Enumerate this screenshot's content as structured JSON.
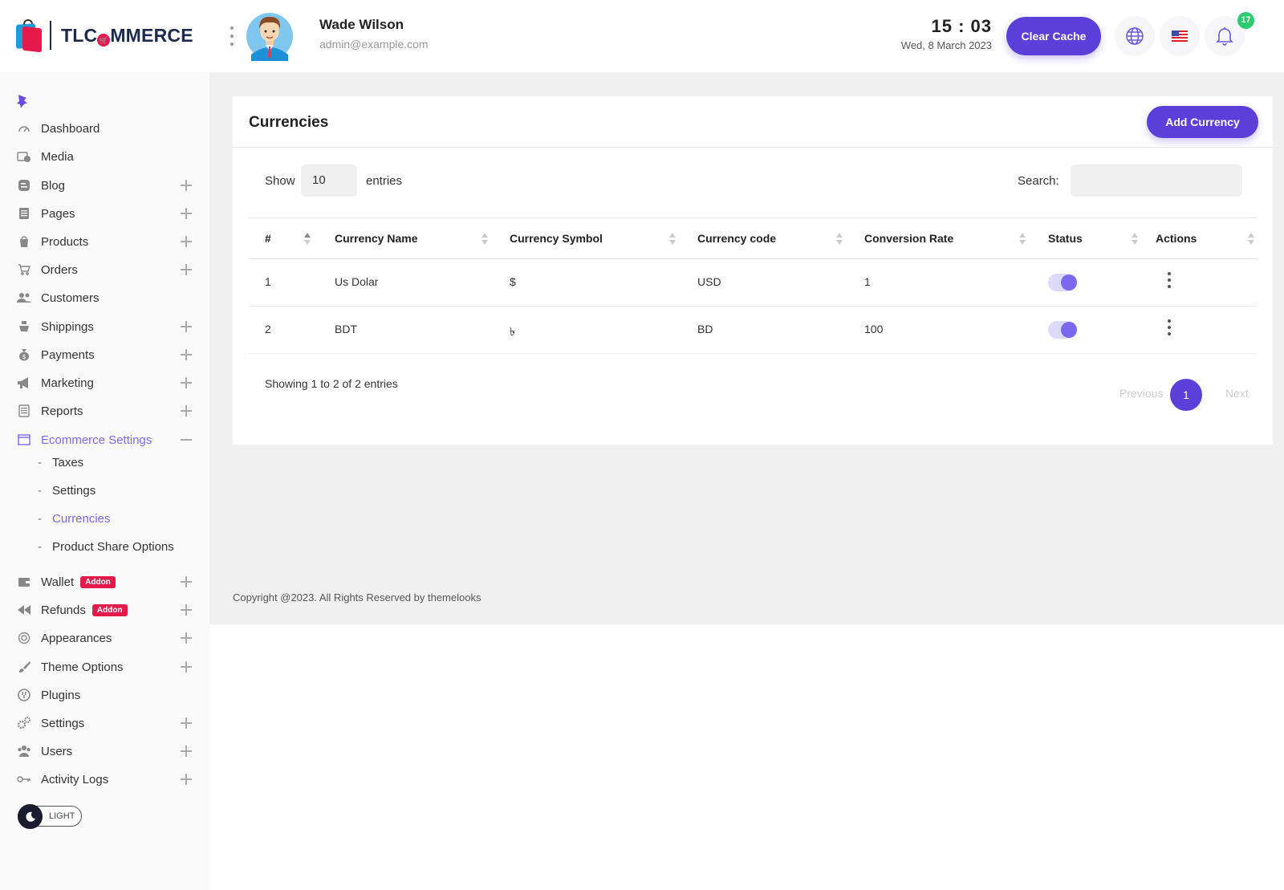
{
  "header": {
    "logo_text": "TLCOMMERCE",
    "user_name": "Wade Wilson",
    "user_email": "admin@example.com",
    "time": "15 : 03",
    "date": "Wed, 8 March 2023",
    "clear_cache_label": "Clear Cache",
    "notification_count": "17",
    "accent_color": "#5b3fd9"
  },
  "sidebar": {
    "items": [
      {
        "label": "Dashboard",
        "icon": "dashboard-icon",
        "expandable": false
      },
      {
        "label": "Media",
        "icon": "media-icon",
        "expandable": false
      },
      {
        "label": "Blog",
        "icon": "blog-icon",
        "expandable": true
      },
      {
        "label": "Pages",
        "icon": "pages-icon",
        "expandable": true
      },
      {
        "label": "Products",
        "icon": "products-icon",
        "expandable": true
      },
      {
        "label": "Orders",
        "icon": "cart-icon",
        "expandable": true
      },
      {
        "label": "Customers",
        "icon": "customers-icon",
        "expandable": false
      },
      {
        "label": "Shippings",
        "icon": "shipping-icon",
        "expandable": true
      },
      {
        "label": "Payments",
        "icon": "money-bag-icon",
        "expandable": true
      },
      {
        "label": "Marketing",
        "icon": "megaphone-icon",
        "expandable": true
      },
      {
        "label": "Reports",
        "icon": "report-icon",
        "expandable": true
      },
      {
        "label": "Ecommerce Settings",
        "icon": "window-icon",
        "expandable": true,
        "expanded": true
      }
    ],
    "sub_items": [
      {
        "label": "Taxes"
      },
      {
        "label": "Settings"
      },
      {
        "label": "Currencies",
        "active": true
      },
      {
        "label": "Product Share Options"
      }
    ],
    "items_after": [
      {
        "label": "Wallet",
        "icon": "wallet-icon",
        "badge": "Addon",
        "expandable": true
      },
      {
        "label": "Refunds",
        "icon": "rewind-icon",
        "badge": "Addon",
        "expandable": true
      },
      {
        "label": "Appearances",
        "icon": "appearance-icon",
        "expandable": true
      },
      {
        "label": "Theme Options",
        "icon": "brush-icon",
        "expandable": true
      },
      {
        "label": "Plugins",
        "icon": "plug-icon",
        "expandable": false
      },
      {
        "label": "Settings",
        "icon": "gears-icon",
        "expandable": true
      },
      {
        "label": "Users",
        "icon": "users-icon",
        "expandable": true
      },
      {
        "label": "Activity Logs",
        "icon": "key-icon",
        "expandable": true
      }
    ],
    "theme_toggle_label": "LIGHT"
  },
  "main": {
    "title": "Currencies",
    "add_button_label": "Add Currency",
    "show_label": "Show",
    "entries_value": "10",
    "entries_label": "entries",
    "search_label": "Search:",
    "search_value": "",
    "columns": [
      "#",
      "Currency Name",
      "Currency Symbol",
      "Currency code",
      "Conversion Rate",
      "Status",
      "Actions"
    ],
    "rows": [
      {
        "num": "1",
        "name": "Us Dolar",
        "symbol": "$",
        "code": "USD",
        "rate": "1",
        "status": true
      },
      {
        "num": "2",
        "name": "BDT",
        "symbol": "৳",
        "code": "BD",
        "rate": "100",
        "status": true
      }
    ],
    "showing_text": "Showing 1 to 2 of 2 entries",
    "pagination": {
      "previous": "Previous",
      "current": "1",
      "next": "Next"
    }
  },
  "footer": {
    "copyright": "Copyright @2023. All Rights Reserved by themelooks"
  }
}
